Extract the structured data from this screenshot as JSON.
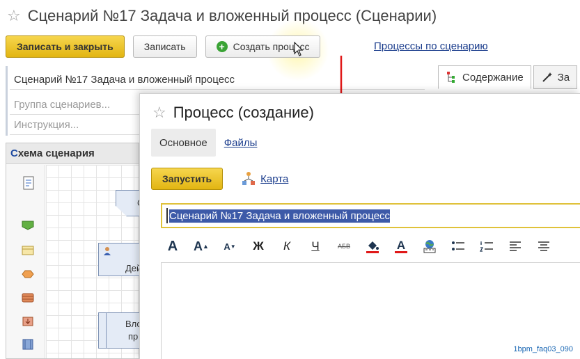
{
  "back_window": {
    "title": "Сценарий №17 Задача и вложенный процесс (Сценарии)",
    "toolbar": {
      "save_close": "Записать и закрыть",
      "save": "Записать",
      "create_process": "Создать процесс",
      "processes_link": "Процессы по сценарию"
    },
    "name_value": "Сценарий №17 Задача и вложенный процесс",
    "group_placeholder": "Группа сценариев...",
    "instruction_placeholder": "Инструкция...",
    "tabs": [
      "Содержание",
      "За"
    ],
    "schema": {
      "title_first": "С",
      "title_rest": "хема сценария",
      "shape_labels": [
        "С",
        "Дей",
        "Вло",
        "пр"
      ]
    }
  },
  "front_window": {
    "title": "Процесс (создание)",
    "tabs": [
      "Основное",
      "Файлы"
    ],
    "run_button": "Запустить",
    "map_link": "Карта",
    "subject_value": "Сценарий №17 Задача и вложенный процесс",
    "format_buttons": [
      "A",
      "A",
      "A",
      "Ж",
      "К",
      "Ч",
      "АБВ",
      "A"
    ]
  },
  "watermark": "1bpm_faq03_090",
  "colors": {
    "primary_button": "#e6bc1c",
    "link": "#1a3c8c",
    "selection": "#3d5aa8",
    "arrow": "#e01818"
  }
}
